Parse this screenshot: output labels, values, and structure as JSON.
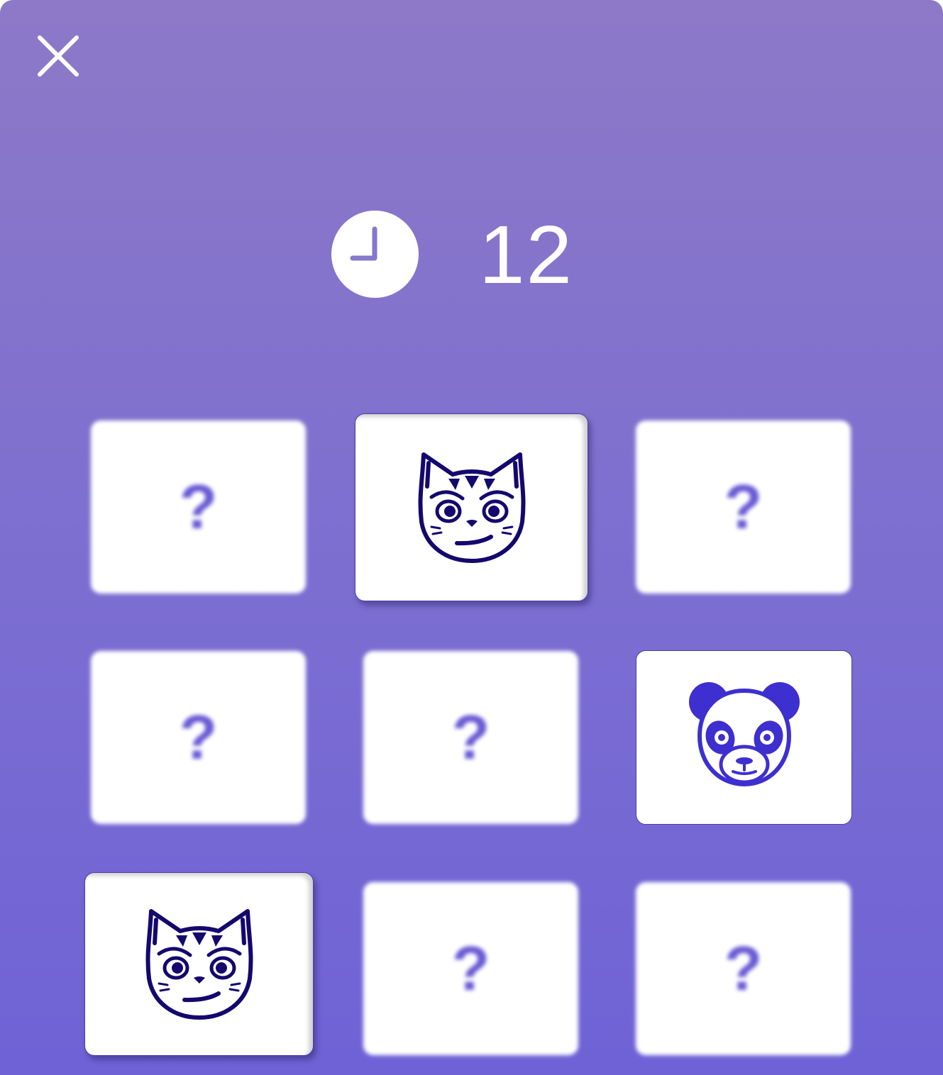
{
  "header": {
    "close_icon": "close-icon"
  },
  "timer": {
    "icon": "clock-icon",
    "value": "12"
  },
  "cards": [
    {
      "state": "hidden",
      "label": "?"
    },
    {
      "state": "flipped",
      "animal": "cat"
    },
    {
      "state": "hidden",
      "label": "?"
    },
    {
      "state": "hidden",
      "label": "?"
    },
    {
      "state": "hidden",
      "label": "?"
    },
    {
      "state": "open",
      "animal": "panda"
    },
    {
      "state": "flipped",
      "animal": "cat"
    },
    {
      "state": "hidden",
      "label": "?"
    },
    {
      "state": "hidden",
      "label": "?"
    }
  ],
  "colors": {
    "background_top": "#8d79c7",
    "background_bottom": "#6f62d6",
    "card": "#ffffff",
    "question_mark": "#6a5ad4",
    "cat_ink": "#14086e",
    "panda_ink": "#3d2fd0"
  }
}
